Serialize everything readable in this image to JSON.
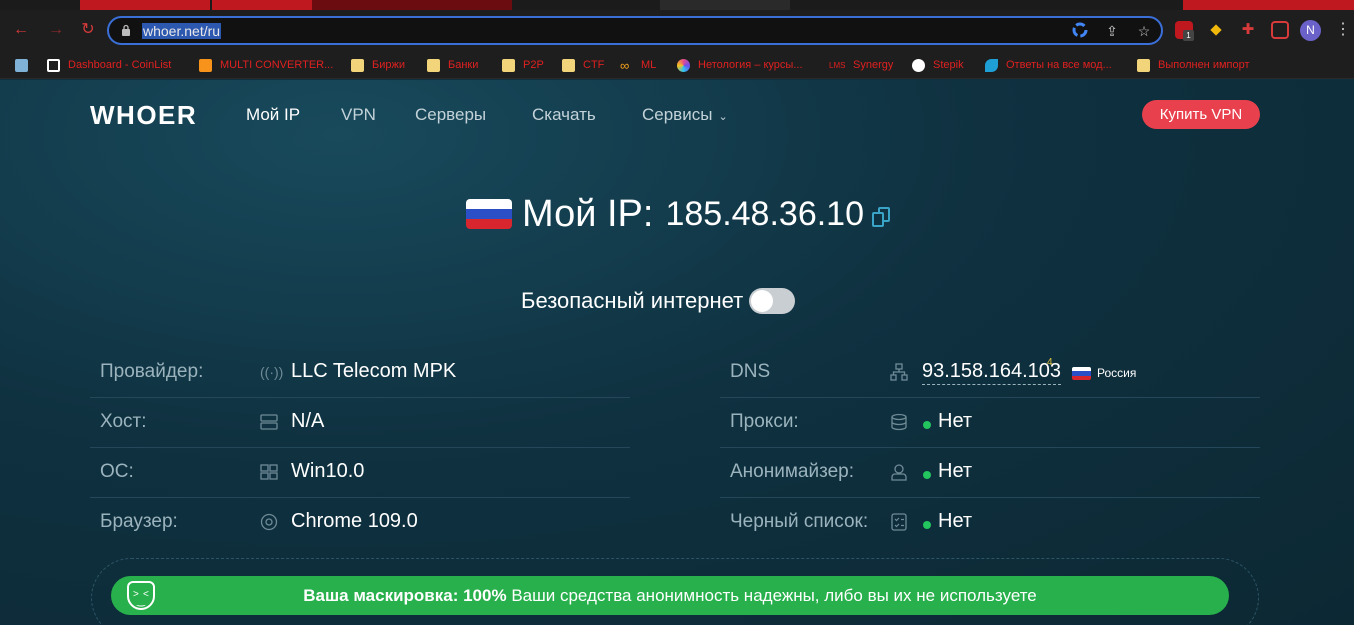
{
  "browser": {
    "url": "whoer.net/ru",
    "avatar_initial": "N",
    "bookmarks": [
      {
        "label": "Dashboard - CoinList",
        "icon": "coinlist-icon",
        "color": "#ffffff"
      },
      {
        "label": "MULTI CONVERTER...",
        "icon": "bitcoin-icon",
        "color": "#f7931a"
      },
      {
        "label": "Биржи",
        "icon": "folder-icon",
        "color": "#f2d57a"
      },
      {
        "label": "Банки",
        "icon": "folder-icon",
        "color": "#f2d57a"
      },
      {
        "label": "P2P",
        "icon": "folder-icon",
        "color": "#f2d57a"
      },
      {
        "label": "CTF",
        "icon": "folder-icon",
        "color": "#f2d57a"
      },
      {
        "label": "ML",
        "icon": "infinity-icon",
        "color": "#f7a21a"
      },
      {
        "label": "Нетология – курсы...",
        "icon": "netology-icon",
        "color": "#6b4ef0"
      },
      {
        "label": "Synergy",
        "icon": "lms-icon",
        "color": "#e02020"
      },
      {
        "label": "Stepik",
        "icon": "stepik-icon",
        "color": "#ffffff"
      },
      {
        "label": "Ответы на все мод...",
        "icon": "leaf-icon",
        "color": "#1e9fd6"
      },
      {
        "label": "Выполнен импорт",
        "icon": "folder-icon",
        "color": "#f2d57a"
      }
    ],
    "lms_text": "LMS",
    "ext_abp_badge": "1"
  },
  "site": {
    "logo": "WHOER",
    "nav": [
      {
        "label": "Мой IP",
        "active": true
      },
      {
        "label": "VPN",
        "active": false
      },
      {
        "label": "Серверы",
        "active": false
      },
      {
        "label": "Скачать",
        "active": false
      },
      {
        "label": "Сервисы",
        "active": false
      }
    ],
    "buy_label": "Купить VPN",
    "ip_label": "Мой IP:",
    "ip_value": "185.48.36.10",
    "safe_internet_label": "Безопасный интернет",
    "safe_internet_on": false
  },
  "info_left": [
    {
      "key": "Провайдер:",
      "icon": "broadcast-icon",
      "value": "LLC Telecom MPK"
    },
    {
      "key": "Хост:",
      "icon": "server-icon",
      "value": "N/A"
    },
    {
      "key": "ОС:",
      "icon": "windows-icon",
      "value": "Win10.0"
    },
    {
      "key": "Браузер:",
      "icon": "chrome-icon",
      "value": "Chrome 109.0"
    }
  ],
  "info_right": [
    {
      "key": "DNS",
      "icon": "network-icon",
      "value": "93.158.164.103",
      "superscript": "4",
      "country": "Россия"
    },
    {
      "key": "Прокси:",
      "icon": "database-icon",
      "value": "Нет",
      "status_color": "#22c55e"
    },
    {
      "key": "Анонимайзер:",
      "icon": "incognito-icon",
      "value": "Нет",
      "status_color": "#22c55e"
    },
    {
      "key": "Черный список:",
      "icon": "checklist-icon",
      "value": "Нет",
      "status_color": "#22c55e"
    }
  ],
  "mask": {
    "bold": "Ваша маскировка: 100%",
    "text": " Ваши средства анонимность надежны, либо вы их не используете"
  },
  "colors": {
    "accent_red": "#e8414d",
    "success_green": "#27b04b",
    "page_bg": "#0e2f3c"
  }
}
